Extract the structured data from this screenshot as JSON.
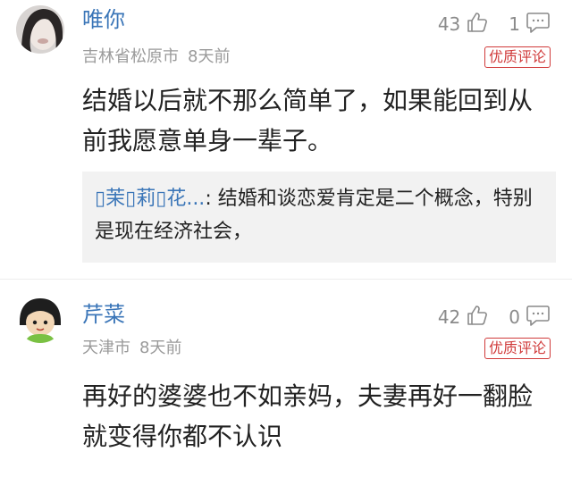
{
  "comments": [
    {
      "name": "唯你",
      "location": "吉林省松原市",
      "time": "8天前",
      "likes": "43",
      "replies": "1",
      "badge": "优质评论",
      "text": "结婚以后就不那么简单了，如果能回到从前我愿意单身一辈子。",
      "reply": {
        "name": "▯茉▯莉▯花...",
        "sep": ":",
        "text": "结婚和谈恋爱肯定是二个概念，特别是现在经济社会，"
      }
    },
    {
      "name": "芹菜",
      "location": "天津市",
      "time": "8天前",
      "likes": "42",
      "replies": "0",
      "badge": "优质评论",
      "text": "再好的婆婆也不如亲妈，夫妻再好一翻脸就变得你都不认识"
    }
  ],
  "icons": {
    "like": "thumbs-up-icon",
    "reply": "comment-bubble-icon"
  },
  "colors": {
    "name": "#3b76b8",
    "badge": "#d03a3a",
    "meta": "#9a9a9a",
    "reply_bg": "#f2f2f2"
  }
}
